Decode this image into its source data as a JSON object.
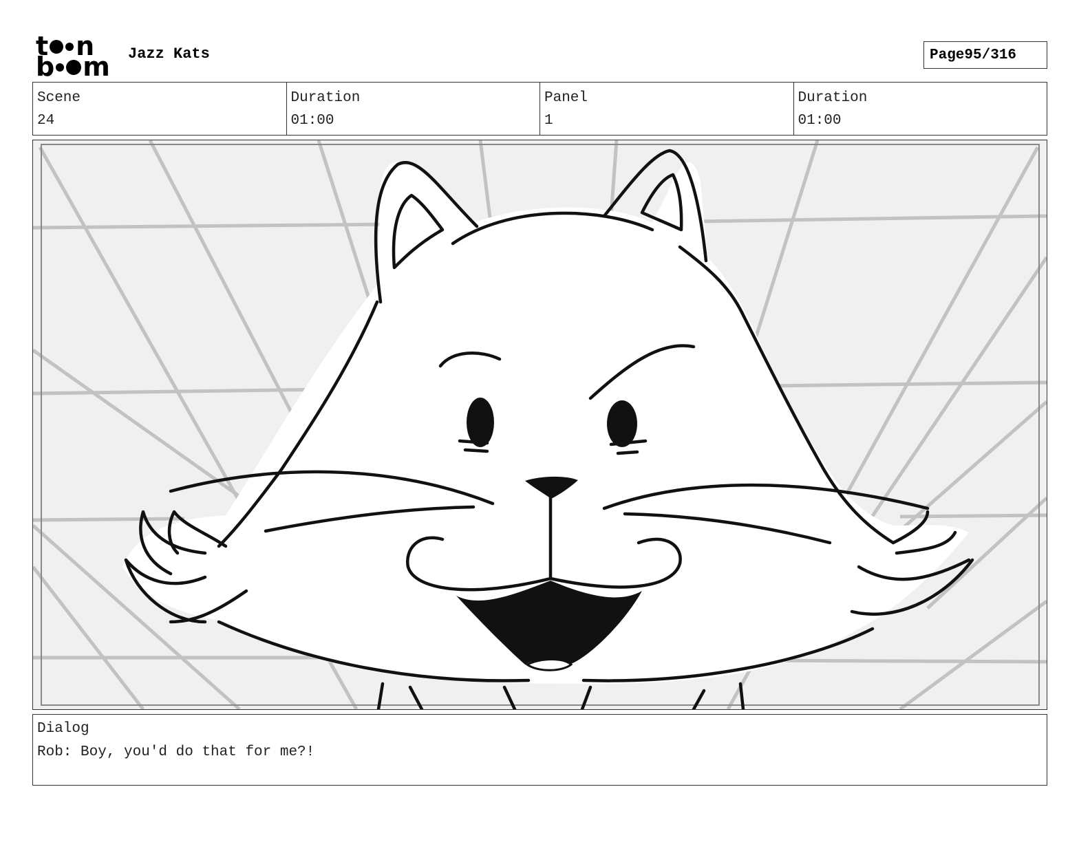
{
  "header": {
    "logo_top": "t",
    "logo_top_end": "n",
    "logo_bottom_start": "b",
    "logo_bottom_end": "m",
    "project_title": "Jazz Kats",
    "page_label": "Page",
    "page_number": "95/316"
  },
  "info": {
    "scene_label": "Scene",
    "scene_value": "24",
    "scene_duration_label": "Duration",
    "scene_duration_value": "01:00",
    "panel_label": "Panel",
    "panel_value": "1",
    "panel_duration_label": "Duration",
    "panel_duration_value": "01:00"
  },
  "dialog": {
    "label": "Dialog",
    "text": "Rob: Boy, you'd do that for me?!"
  }
}
